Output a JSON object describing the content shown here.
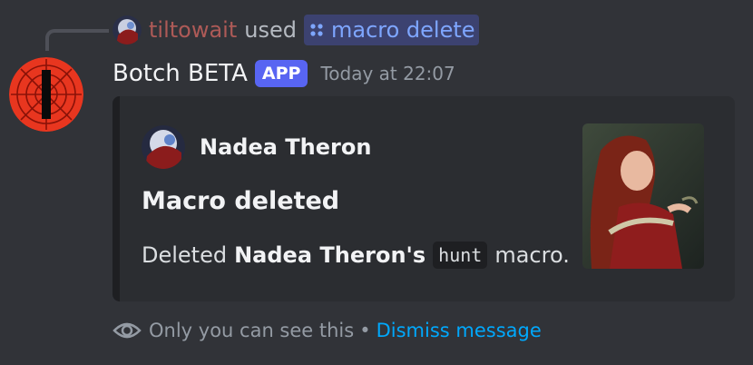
{
  "reply": {
    "user": "tiltowait",
    "verb": "used",
    "command": "macro delete"
  },
  "message": {
    "author": "Botch BETA",
    "badge": "APP",
    "timestamp": "Today at 22:07"
  },
  "embed": {
    "author_name": "Nadea Theron",
    "title": "Macro deleted",
    "description": {
      "prefix": "Deleted",
      "bold": "Nadea Theron's",
      "code": "hunt",
      "suffix": "macro."
    }
  },
  "ephemeral": {
    "notice": "Only you can see this",
    "separator": "•",
    "dismiss": "Dismiss message"
  },
  "colors": {
    "background": "#313338",
    "embed_bg": "#2b2d31",
    "username": "#ad5a57",
    "command_pill": "#3c4270",
    "command_text": "#7ea6ff",
    "app_badge": "#5865f2",
    "link": "#00a8fc"
  },
  "icons": {
    "command": "slash-command-icon",
    "ephemeral": "eye-icon"
  }
}
